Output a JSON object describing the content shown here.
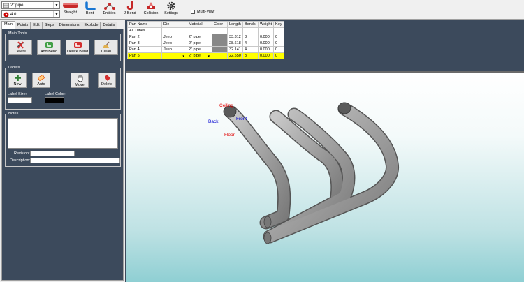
{
  "toolbar": {
    "material_select": "2\" pipe",
    "size_select": "4.0",
    "buttons": {
      "straight": "Straight",
      "bent": "Bent",
      "entities": "Entities",
      "jbend": "J-Bend",
      "collision": "Collision",
      "settings": "Settings"
    },
    "multiview_label": "Multi-View",
    "multiview_checked": false
  },
  "left_panel": {
    "tabs": [
      "Main",
      "Points",
      "Edit",
      "Steps",
      "Dimensions",
      "Explode",
      "Details"
    ],
    "active_tab": "Main",
    "main_tools": {
      "title": "Main Tools",
      "delete": "Delete",
      "add_bend": "Add Bend",
      "delete_bend": "Delete Bend",
      "clean": "Clean"
    },
    "labels": {
      "title": "Labels",
      "new": "New",
      "auto": "Auto",
      "move": "Move",
      "delete": "Delete",
      "label_size": "Label Size:",
      "label_color": "Label Color:",
      "label_size_value": "",
      "label_color_value": "#000000"
    },
    "notes": {
      "title": "Notes",
      "revision_label": "Revision:",
      "description_label": "Description:",
      "revision_value": "",
      "description_value": ""
    }
  },
  "grid": {
    "headers": [
      "Part Name",
      "Die",
      "Material",
      "Color",
      "Length",
      "Bends",
      "Weight",
      "Key"
    ],
    "rows": [
      {
        "name": "All Tubes",
        "die": "",
        "material": "",
        "color": "",
        "length": "",
        "bends": "",
        "weight": "",
        "key": "",
        "selected": false,
        "swatch": false
      },
      {
        "name": "Part 2",
        "die": "Jeep",
        "material": "2\" pipe",
        "color": "",
        "length": "33.312",
        "bends": "3",
        "weight": "0.000",
        "key": "0",
        "selected": false,
        "swatch": true
      },
      {
        "name": "Part 3",
        "die": "Jeep",
        "material": "2\" pipe",
        "color": "",
        "length": "28.618",
        "bends": "4",
        "weight": "0.000",
        "key": "0",
        "selected": false,
        "swatch": true
      },
      {
        "name": "Part 4",
        "die": "Jeep",
        "material": "2\" pipe",
        "color": "",
        "length": "32.141",
        "bends": "4",
        "weight": "0.000",
        "key": "0",
        "selected": false,
        "swatch": true
      },
      {
        "name": "Part 5",
        "die": "",
        "material": "2\" pipe",
        "color": "",
        "length": "22.550",
        "bends": "3",
        "weight": "0.000",
        "key": "0",
        "selected": true,
        "swatch": false
      }
    ]
  },
  "viewport": {
    "labels": {
      "ceiling": "Ceiling",
      "back": "Back",
      "front": "Front",
      "floor": "Floor"
    },
    "colors": {
      "ceiling": "#e00000",
      "floor": "#e00000",
      "back": "#0000d0",
      "front": "#0000d0",
      "tube": "#9a9a9a"
    }
  }
}
